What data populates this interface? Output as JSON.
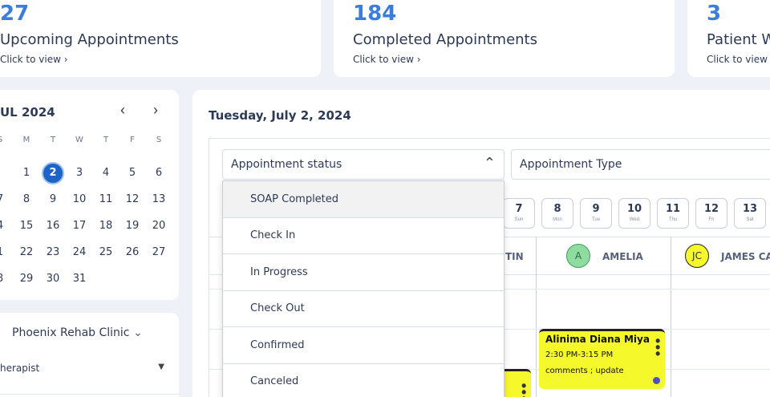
{
  "stats": [
    {
      "number": "27",
      "label": "Upcoming Appointments",
      "link": "Click to view"
    },
    {
      "number": "184",
      "label": "Completed Appointments",
      "link": "Click to view"
    },
    {
      "number": "3",
      "label": "Patient W",
      "link": "Click to view"
    }
  ],
  "calendar": {
    "title": "UL 2024",
    "weekdays": [
      "S",
      "M",
      "T",
      "W",
      "T",
      "F",
      "S"
    ],
    "weeks": [
      [
        "",
        "1",
        "2",
        "3",
        "4",
        "5",
        "6"
      ],
      [
        "7",
        "8",
        "9",
        "10",
        "11",
        "12",
        "13"
      ],
      [
        "4",
        "15",
        "16",
        "17",
        "18",
        "19",
        "20"
      ],
      [
        "1",
        "22",
        "23",
        "24",
        "25",
        "26",
        "27"
      ],
      [
        "8",
        "29",
        "30",
        "31",
        "",
        "",
        ""
      ]
    ],
    "selected": "2"
  },
  "clinic": {
    "name": "Phoenix Rehab Clinic",
    "therapist_label": "herapist"
  },
  "main": {
    "date": "Tuesday, July 2, 2024",
    "status_filter": "Appointment status",
    "type_filter": "Appointment Type"
  },
  "status_options": [
    "SOAP Completed",
    "Check In",
    "In Progress",
    "Check Out",
    "Confirmed",
    "Canceled"
  ],
  "day_pills": [
    {
      "num": "7",
      "dow": "Sun"
    },
    {
      "num": "8",
      "dow": "Mon"
    },
    {
      "num": "9",
      "dow": "Tue"
    },
    {
      "num": "10",
      "dow": "Wed"
    },
    {
      "num": "11",
      "dow": "Thu"
    },
    {
      "num": "12",
      "dow": "Fri"
    },
    {
      "num": "13",
      "dow": "Sat"
    }
  ],
  "columns": [
    {
      "name": "TIN",
      "initials": ""
    },
    {
      "name": "AMELIA",
      "initials": "A",
      "color": "#8fdca1"
    },
    {
      "name": "JAMES CA",
      "initials": "JC",
      "color": "#f5f82a"
    }
  ],
  "appointment": {
    "patient": "Alinima Diana Miya",
    "time": "2:30 PM-3:15 PM",
    "comments": "comments ; update"
  },
  "colors": {
    "accent": "#3b7ddd",
    "selected_day": "#1e63c7",
    "appointment": "#f5f82a"
  }
}
